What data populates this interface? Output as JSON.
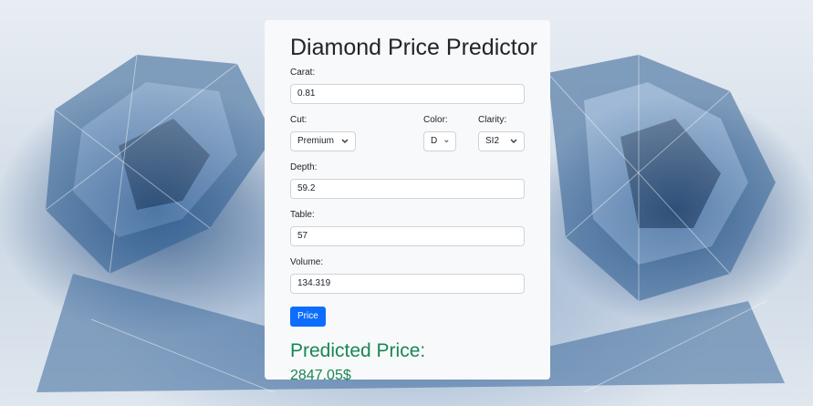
{
  "page": {
    "title": "Diamond Price Predictor"
  },
  "form": {
    "carat": {
      "label": "Carat:",
      "value": "0.81"
    },
    "cut": {
      "label": "Cut:",
      "value": "Premium"
    },
    "color": {
      "label": "Color:",
      "value": "D"
    },
    "clarity": {
      "label": "Clarity:",
      "value": "SI2"
    },
    "depth": {
      "label": "Depth:",
      "value": "59.2"
    },
    "table": {
      "label": "Table:",
      "value": "57"
    },
    "volume": {
      "label": "Volume:",
      "value": "134.319"
    },
    "submit_label": "Price"
  },
  "result": {
    "title": "Predicted Price:",
    "value": "2847.05$"
  },
  "colors": {
    "accent": "#0d6efd",
    "success": "#198754",
    "card_bg": "#f8f9fa"
  }
}
